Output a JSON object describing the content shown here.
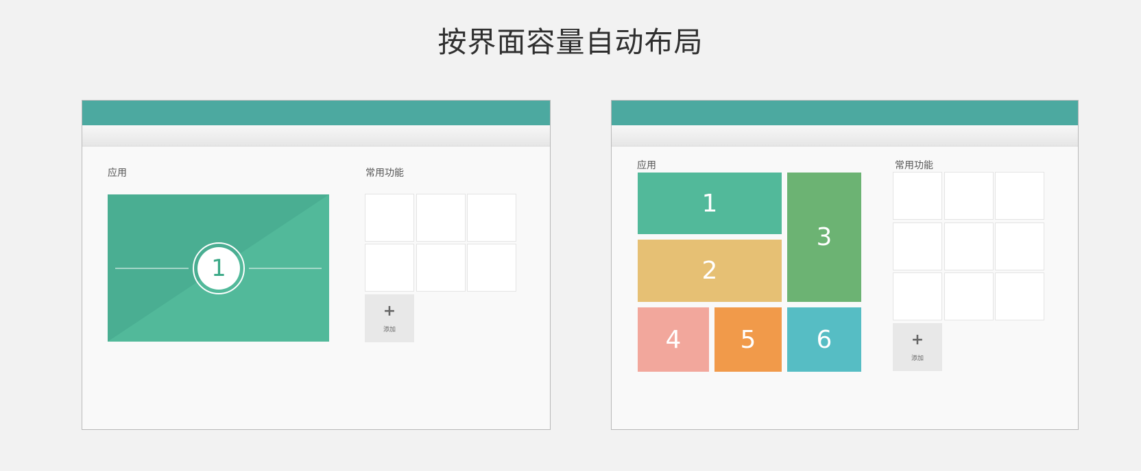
{
  "title": "按界面容量自动布局",
  "left_window": {
    "apps_label": "应用",
    "common_label": "常用功能",
    "hero_number": "1",
    "add_label": "添加",
    "add_icon": "plus-icon"
  },
  "right_window": {
    "apps_label": "应用",
    "common_label": "常用功能",
    "add_label": "添加",
    "add_icon": "plus-icon",
    "blocks": [
      {
        "label": "1",
        "color": "#52b99a"
      },
      {
        "label": "2",
        "color": "#e6c074"
      },
      {
        "label": "3",
        "color": "#6cb373"
      },
      {
        "label": "4",
        "color": "#f2a79c"
      },
      {
        "label": "5",
        "color": "#f19a4a"
      },
      {
        "label": "6",
        "color": "#56bdc4"
      }
    ]
  },
  "colors": {
    "titlebar": "#4ca9a0",
    "hero_dark": "#4aae92",
    "hero_light": "#52b99a"
  }
}
